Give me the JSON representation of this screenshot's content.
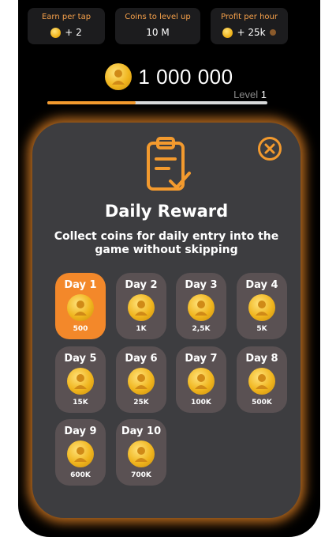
{
  "stats": [
    {
      "label": "Earn per tap",
      "value": "+ 2",
      "coin": true,
      "info": false
    },
    {
      "label": "Coins to level up",
      "value": "10 M",
      "coin": false,
      "info": false
    },
    {
      "label": "Profit per hour",
      "value": "+ 25k",
      "coin": true,
      "info": true
    }
  ],
  "balance": {
    "amount": "1 000 000"
  },
  "level": {
    "label": "Level",
    "value": "1",
    "progress_fraction": 0.4
  },
  "modal": {
    "title": "Daily Reward",
    "subtitle": "Collect coins for daily entry into the game without skipping",
    "days": [
      {
        "label": "Day 1",
        "reward": "500",
        "active": true
      },
      {
        "label": "Day 2",
        "reward": "1K",
        "active": false
      },
      {
        "label": "Day 3",
        "reward": "2,5K",
        "active": false
      },
      {
        "label": "Day 4",
        "reward": "5K",
        "active": false
      },
      {
        "label": "Day 5",
        "reward": "15K",
        "active": false
      },
      {
        "label": "Day 6",
        "reward": "25K",
        "active": false
      },
      {
        "label": "Day 7",
        "reward": "100K",
        "active": false
      },
      {
        "label": "Day 8",
        "reward": "500K",
        "active": false
      },
      {
        "label": "Day 9",
        "reward": "600K",
        "active": false
      },
      {
        "label": "Day 10",
        "reward": "700K",
        "active": false
      }
    ]
  },
  "colors": {
    "accent": "#f39a2e",
    "modal_bg": "#3d3d40",
    "day_bg": "#5a5153",
    "active_day": "#f3882a"
  }
}
